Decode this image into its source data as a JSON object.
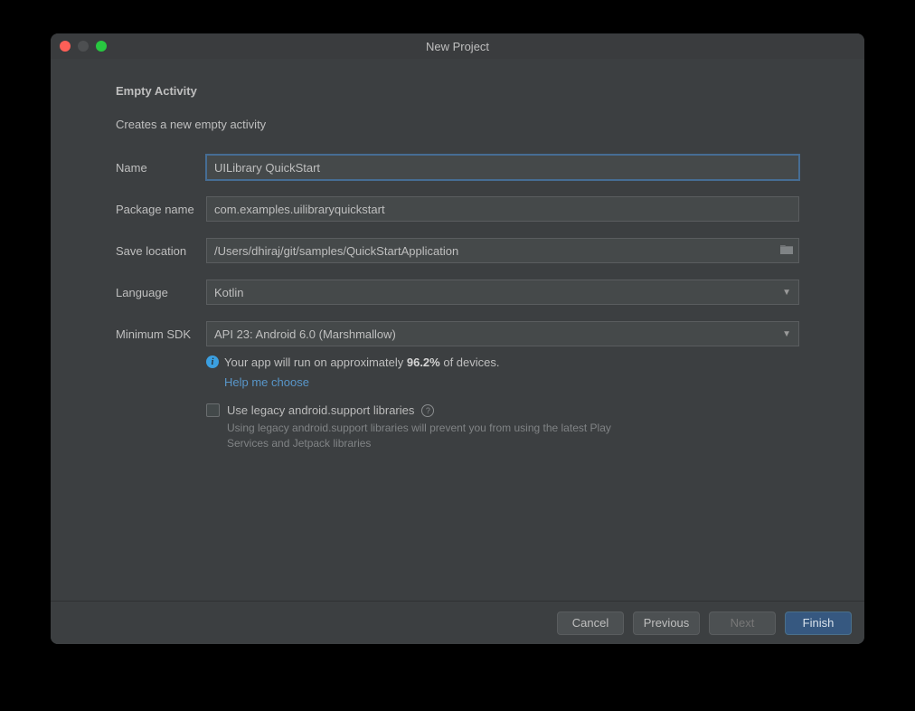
{
  "window": {
    "title": "New Project"
  },
  "heading": "Empty Activity",
  "description": "Creates a new empty activity",
  "form": {
    "name": {
      "label": "Name",
      "value": "UILibrary QuickStart"
    },
    "package": {
      "label": "Package name",
      "value": "com.examples.uilibraryquickstart"
    },
    "save": {
      "label": "Save location",
      "value": "/Users/dhiraj/git/samples/QuickStartApplication"
    },
    "language": {
      "label": "Language",
      "value": "Kotlin"
    },
    "minsdk": {
      "label": "Minimum SDK",
      "value": "API 23: Android 6.0 (Marshmallow)"
    }
  },
  "info": {
    "prefix": "Your app will run on approximately ",
    "percent": "96.2%",
    "suffix": " of devices.",
    "help_link": "Help me choose"
  },
  "legacy": {
    "label": "Use legacy android.support libraries",
    "hint": "Using legacy android.support libraries will prevent you from using the latest Play Services and Jetpack libraries"
  },
  "buttons": {
    "cancel": "Cancel",
    "previous": "Previous",
    "next": "Next",
    "finish": "Finish"
  }
}
